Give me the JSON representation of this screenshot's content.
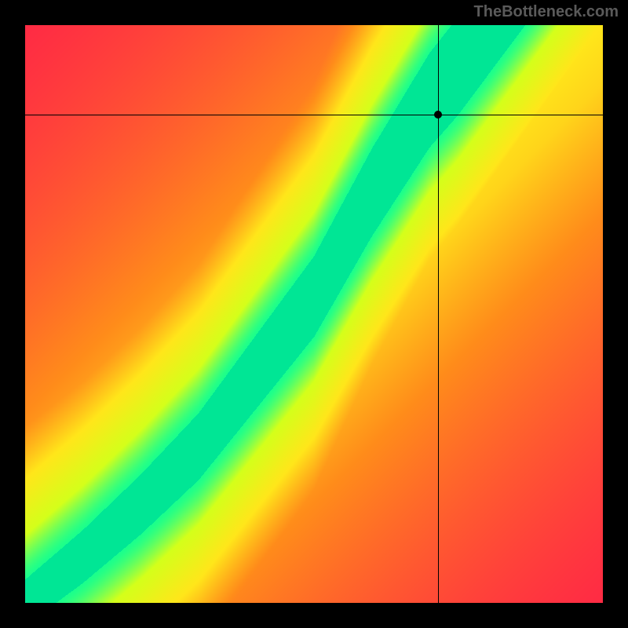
{
  "watermark": "TheBottleneck.com",
  "chart_data": {
    "type": "heatmap",
    "title": "",
    "xlabel": "",
    "ylabel": "",
    "xlim": [
      0,
      100
    ],
    "ylim": [
      0,
      100
    ],
    "grid": false,
    "marker": {
      "x": 71.5,
      "y": 84.5
    },
    "crosshair": {
      "x": 71.5,
      "y": 84.5
    },
    "color_stops": [
      {
        "value": 0.0,
        "color": "#ff1a4b"
      },
      {
        "value": 0.35,
        "color": "#ff8c1a"
      },
      {
        "value": 0.55,
        "color": "#ffe61a"
      },
      {
        "value": 0.78,
        "color": "#d4ff1a"
      },
      {
        "value": 0.92,
        "color": "#1aff8c"
      },
      {
        "value": 1.0,
        "color": "#00e695"
      }
    ],
    "optimal_curve": [
      {
        "x": 0,
        "y": 0
      },
      {
        "x": 10,
        "y": 8
      },
      {
        "x": 20,
        "y": 17
      },
      {
        "x": 30,
        "y": 27
      },
      {
        "x": 40,
        "y": 40
      },
      {
        "x": 50,
        "y": 53
      },
      {
        "x": 55,
        "y": 62
      },
      {
        "x": 60,
        "y": 71
      },
      {
        "x": 65,
        "y": 79
      },
      {
        "x": 70,
        "y": 87
      },
      {
        "x": 75,
        "y": 93
      },
      {
        "x": 80,
        "y": 100
      }
    ],
    "description": "Heatmap showing optimal component pairing. Green diagonal band indicates balanced combinations; red corners indicate severe bottleneck. Marker point sits on the green band near upper region."
  },
  "colors": {
    "background": "#000000",
    "watermark": "#5a5a5a"
  }
}
